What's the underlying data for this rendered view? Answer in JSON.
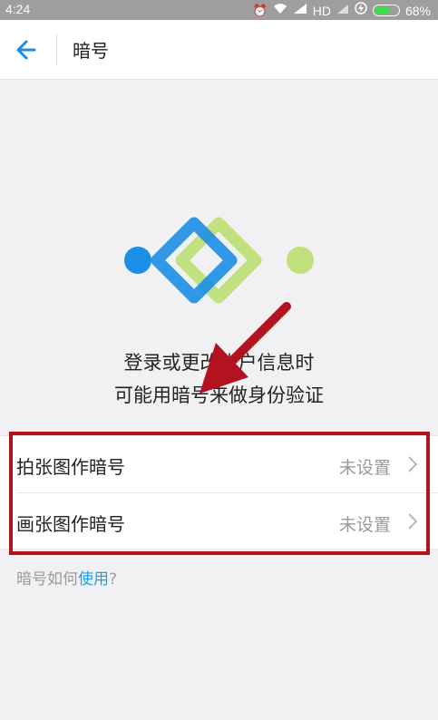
{
  "status_bar": {
    "time": "4:24",
    "network": "HD",
    "battery_percent": "68%",
    "battery_level": 0.68
  },
  "header": {
    "title": "暗号"
  },
  "hero": {
    "line1": "登录或更改账户信息时",
    "line2": "可能用暗号来做身份验证",
    "colors": {
      "blue": "#1b8ee6",
      "green": "#bfe07a"
    }
  },
  "options": [
    {
      "label": "拍张图作暗号",
      "value": "未设置"
    },
    {
      "label": "画张图作暗号",
      "value": "未设置"
    }
  ],
  "help": {
    "prefix": "暗号如何",
    "link": "使用",
    "suffix": "?"
  },
  "colors": {
    "accent": "#1d9ee8",
    "annotation": "#b3121f"
  }
}
